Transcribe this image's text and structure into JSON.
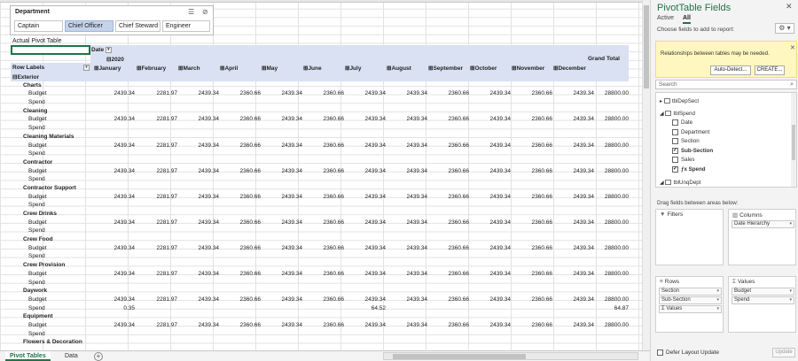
{
  "slicer": {
    "header": "Department",
    "items": [
      {
        "label": "Captain",
        "selected": false
      },
      {
        "label": "Chief Officer",
        "selected": true
      },
      {
        "label": "Chief Steward",
        "selected": false
      },
      {
        "label": "Engineer",
        "selected": false
      }
    ]
  },
  "pivot": {
    "title": "Actual Pivot Table",
    "date_field": "Date",
    "year": "2020",
    "row_labels_header": "Row Labels",
    "grand_total_header": "Grand Total",
    "months": [
      "January",
      "February",
      "March",
      "April",
      "May",
      "June",
      "July",
      "August",
      "September",
      "October",
      "November",
      "December"
    ],
    "top_group": "Exterior",
    "groups": [
      {
        "name": "Charts",
        "budget": [
          "2439.34",
          "2281.97",
          "2439.34",
          "2360.66",
          "2439.34",
          "2360.66",
          "2439.34",
          "2439.34",
          "2360.66",
          "2439.34",
          "2360.66",
          "2439.34",
          "28800.00"
        ],
        "spend": [
          "",
          "",
          "",
          "",
          "",
          "",
          "",
          "",
          "",
          "",
          "",
          "",
          ""
        ]
      },
      {
        "name": "Cleaning",
        "budget": [
          "2439.34",
          "2281.97",
          "2439.34",
          "2360.66",
          "2439.34",
          "2360.66",
          "2439.34",
          "2439.34",
          "2360.66",
          "2439.34",
          "2360.66",
          "2439.34",
          "28800.00"
        ],
        "spend": [
          "",
          "",
          "",
          "",
          "",
          "",
          "",
          "",
          "",
          "",
          "",
          "",
          ""
        ]
      },
      {
        "name": "Cleaning Materials",
        "budget": [
          "2439.34",
          "2281.97",
          "2439.34",
          "2360.66",
          "2439.34",
          "2360.66",
          "2439.34",
          "2439.34",
          "2360.66",
          "2439.34",
          "2360.66",
          "2439.34",
          "28800.00"
        ],
        "spend": [
          "",
          "",
          "",
          "",
          "",
          "",
          "",
          "",
          "",
          "",
          "",
          "",
          ""
        ]
      },
      {
        "name": "Contractor",
        "budget": [
          "2439.34",
          "2281.97",
          "2439.34",
          "2360.66",
          "2439.34",
          "2360.66",
          "2439.34",
          "2439.34",
          "2360.66",
          "2439.34",
          "2360.66",
          "2439.34",
          "28800.00"
        ],
        "spend": [
          "",
          "",
          "",
          "",
          "",
          "",
          "",
          "",
          "",
          "",
          "",
          "",
          ""
        ]
      },
      {
        "name": "Contractor Support",
        "budget": [
          "2439.34",
          "2281.97",
          "2439.34",
          "2360.66",
          "2439.34",
          "2360.66",
          "2439.34",
          "2439.34",
          "2360.66",
          "2439.34",
          "2360.66",
          "2439.34",
          "28800.00"
        ],
        "spend": [
          "",
          "",
          "",
          "",
          "",
          "",
          "",
          "",
          "",
          "",
          "",
          "",
          ""
        ]
      },
      {
        "name": "Crew Drinks",
        "budget": [
          "2439.34",
          "2281.97",
          "2439.34",
          "2360.66",
          "2439.34",
          "2360.66",
          "2439.34",
          "2439.34",
          "2360.66",
          "2439.34",
          "2360.66",
          "2439.34",
          "28800.00"
        ],
        "spend": [
          "",
          "",
          "",
          "",
          "",
          "",
          "",
          "",
          "",
          "",
          "",
          "",
          ""
        ]
      },
      {
        "name": "Crew Food",
        "budget": [
          "2439.34",
          "2281.97",
          "2439.34",
          "2360.66",
          "2439.34",
          "2360.66",
          "2439.34",
          "2439.34",
          "2360.66",
          "2439.34",
          "2360.66",
          "2439.34",
          "28800.00"
        ],
        "spend": [
          "",
          "",
          "",
          "",
          "",
          "",
          "",
          "",
          "",
          "",
          "",
          "",
          ""
        ]
      },
      {
        "name": "Crew Provision",
        "budget": [
          "2439.34",
          "2281.97",
          "2439.34",
          "2360.66",
          "2439.34",
          "2360.66",
          "2439.34",
          "2439.34",
          "2360.66",
          "2439.34",
          "2360.66",
          "2439.34",
          "28800.00"
        ],
        "spend": [
          "",
          "",
          "",
          "",
          "",
          "",
          "",
          "",
          "",
          "",
          "",
          "",
          ""
        ]
      },
      {
        "name": "Daywork",
        "budget": [
          "2439.34",
          "2281.97",
          "2439.34",
          "2360.66",
          "2439.34",
          "2360.66",
          "2439.34",
          "2439.34",
          "2360.66",
          "2439.34",
          "2360.66",
          "2439.34",
          "28800.00"
        ],
        "spend": [
          "0.35",
          "",
          "",
          "",
          "",
          "",
          "64.52",
          "",
          "",
          "",
          "",
          "",
          "64.87"
        ]
      },
      {
        "name": "Equipment",
        "budget": [
          "2439.34",
          "2281.97",
          "2439.34",
          "2360.66",
          "2439.34",
          "2360.66",
          "2439.34",
          "2439.34",
          "2360.66",
          "2439.34",
          "2360.66",
          "2439.34",
          "28800.00"
        ],
        "spend": [
          "",
          "",
          "",
          "",
          "",
          "",
          "",
          "",
          "",
          "",
          "",
          "",
          ""
        ]
      },
      {
        "name": "Flowers & Decoration"
      }
    ],
    "budget_label": "Budget",
    "spend_label": "Spend"
  },
  "sheet_tabs": {
    "items": [
      "Pivot Tables",
      "Data"
    ],
    "active": "Pivot Tables",
    "add_symbol": "⊕"
  },
  "pane": {
    "title": "PivotTable Fields",
    "tabs": [
      {
        "label": "Active",
        "selected": false
      },
      {
        "label": "All",
        "selected": true
      }
    ],
    "choose_label": "Choose fields to add to report:",
    "notice": {
      "text": "Relationships between tables may be needed.",
      "auto_detect": "Auto-Detect...",
      "create": "CREATE..."
    },
    "search_placeholder": "Search",
    "fields": [
      {
        "label": "tblDepSect",
        "kind": "table",
        "expanded": false
      },
      {
        "label": "tblSpend",
        "kind": "table",
        "expanded": true
      },
      {
        "label": "Date",
        "kind": "field",
        "checked": false
      },
      {
        "label": "Department",
        "kind": "field",
        "checked": false
      },
      {
        "label": "Section",
        "kind": "field",
        "checked": false
      },
      {
        "label": "Sub-Section",
        "kind": "field",
        "checked": true
      },
      {
        "label": "Sales",
        "kind": "field",
        "checked": false
      },
      {
        "label": "Spend",
        "kind": "measure",
        "checked": true
      },
      {
        "label": "tblUnqDept",
        "kind": "table",
        "expanded": true
      }
    ],
    "drag_hint": "Drag fields between areas below:",
    "areas": {
      "filters": {
        "label": "Filters",
        "items": []
      },
      "columns": {
        "label": "Columns",
        "items": [
          "Date Hierarchy"
        ]
      },
      "rows": {
        "label": "Rows",
        "items": [
          "Section",
          "Sub-Section",
          "Values"
        ]
      },
      "values": {
        "label": "Values",
        "items": [
          "Budget",
          "Spend"
        ]
      }
    },
    "defer_label": "Defer Layout Update",
    "update_label": "Update"
  }
}
